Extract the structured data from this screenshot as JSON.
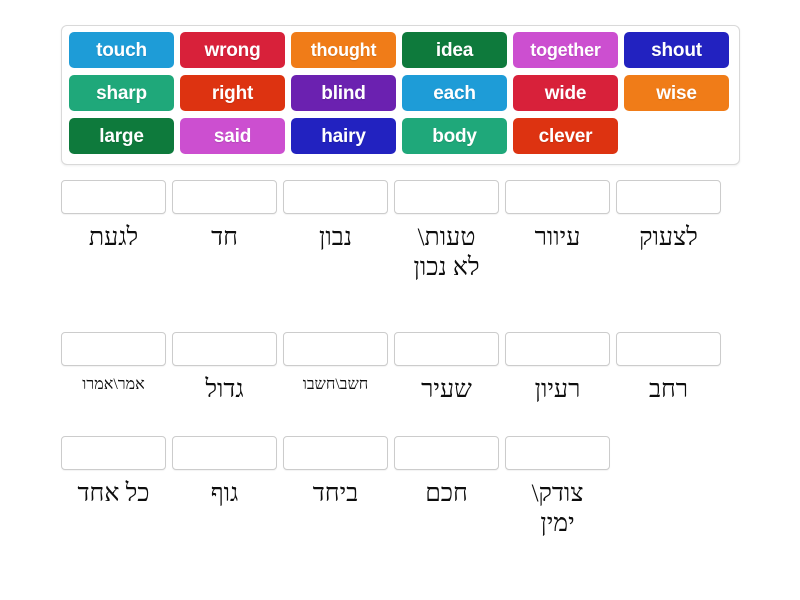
{
  "activity": {
    "type": "match-up",
    "language_pair": "English-Hebrew"
  },
  "word_bank": {
    "rows": [
      [
        {
          "label": "touch",
          "color": "#1e9cd7"
        },
        {
          "label": "wrong",
          "color": "#d8213a"
        },
        {
          "label": "thought",
          "color": "#f07c18"
        },
        {
          "label": "idea",
          "color": "#0e7a3c"
        },
        {
          "label": "together",
          "color": "#cc4fd0"
        },
        {
          "label": "shout",
          "color": "#2222c0"
        }
      ],
      [
        {
          "label": "sharp",
          "color": "#1fa87a"
        },
        {
          "label": "right",
          "color": "#dd3311"
        },
        {
          "label": "blind",
          "color": "#6b21b0"
        },
        {
          "label": "each",
          "color": "#1e9cd7"
        },
        {
          "label": "wide",
          "color": "#d8213a"
        },
        {
          "label": "wise",
          "color": "#f07c18"
        }
      ],
      [
        {
          "label": "large",
          "color": "#0e7a3c"
        },
        {
          "label": "said",
          "color": "#cc4fd0"
        },
        {
          "label": "hairy",
          "color": "#2222c0"
        },
        {
          "label": "body",
          "color": "#1fa87a"
        },
        {
          "label": "clever",
          "color": "#dd3311"
        },
        {
          "label": "",
          "color": ""
        }
      ]
    ]
  },
  "answers": {
    "rows": [
      [
        {
          "label": "לגעת"
        },
        {
          "label": "חד"
        },
        {
          "label": "נבון"
        },
        {
          "label": "טעות\\\nלא נכון"
        },
        {
          "label": "עיוור"
        },
        {
          "label": "לצעוק"
        }
      ],
      [
        {
          "label": "אמר\\אמרו"
        },
        {
          "label": "גדול"
        },
        {
          "label": "חשב\\חשבו"
        },
        {
          "label": "שעיר"
        },
        {
          "label": "רעיון"
        },
        {
          "label": "רחב"
        }
      ],
      [
        {
          "label": "כל אחד"
        },
        {
          "label": "גוף"
        },
        {
          "label": "ביחד"
        },
        {
          "label": "חכם"
        },
        {
          "label": "צודק\\\nימין"
        }
      ]
    ]
  }
}
